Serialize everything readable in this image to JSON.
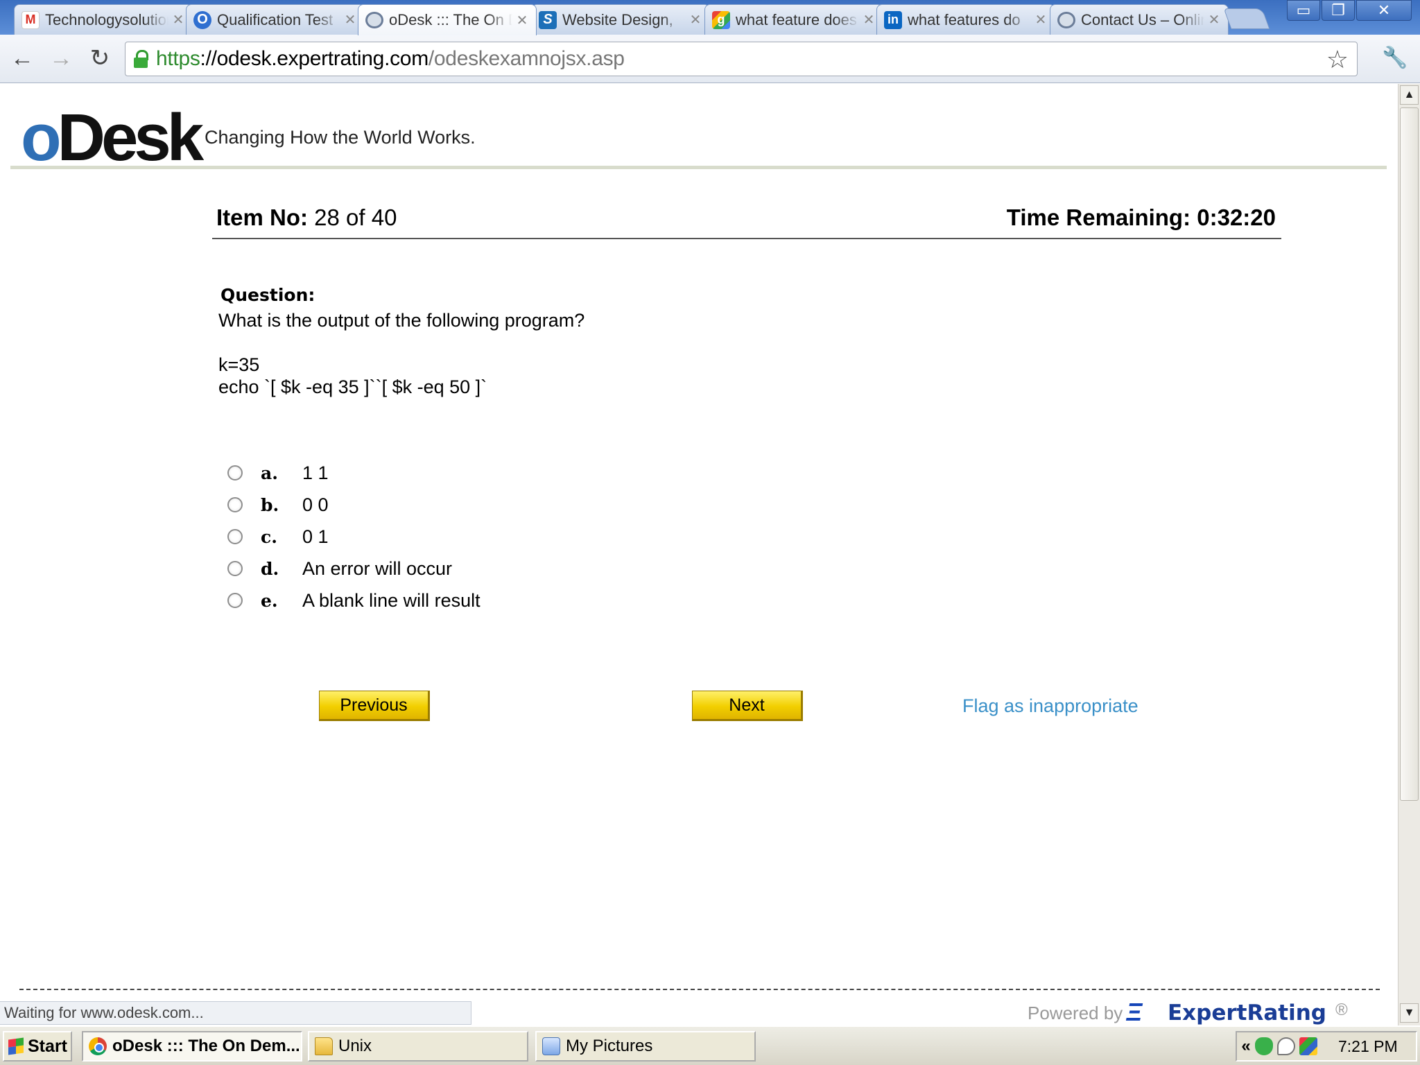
{
  "browser": {
    "tabs": [
      {
        "title": "Technologysolutions",
        "favicon": "gmail-icon",
        "active": false
      },
      {
        "title": "Qualification Test",
        "favicon": "odesk-icon",
        "active": false
      },
      {
        "title": "oDesk ::: The On Demand",
        "favicon": "globe-icon",
        "active": true
      },
      {
        "title": "Website Design,",
        "favicon": "skype-icon",
        "active": false
      },
      {
        "title": "what feature does",
        "favicon": "google-icon",
        "active": false
      },
      {
        "title": "what features do",
        "favicon": "linkedin-icon",
        "active": false
      },
      {
        "title": "Contact Us – Online",
        "favicon": "globe-icon",
        "active": false
      }
    ],
    "close_glyph": "✕",
    "window_buttons": {
      "minimize": "▭",
      "restore": "❐",
      "close": "✕"
    },
    "url": {
      "scheme": "https",
      "separator": "://",
      "host": "odesk.expertrating.com",
      "path": "/odeskexamnojsx.asp"
    },
    "status_text": "Waiting for www.odesk.com..."
  },
  "page": {
    "logo": {
      "o": "o",
      "desk": "Desk"
    },
    "tagline": "Changing How the World Works.",
    "item_label": "Item No:",
    "item_value": "28 of 40",
    "time_label": "Time Remaining:",
    "time_value": "0:32:20",
    "question_heading": "Question:",
    "question_text": "What is the output of the following program?",
    "code_lines": [
      "k=35",
      "echo `[ $k -eq 35 ]``[ $k -eq 50 ]`"
    ],
    "options": [
      {
        "letter": "a.",
        "text": "1 1"
      },
      {
        "letter": "b.",
        "text": "0 0"
      },
      {
        "letter": "c.",
        "text": "0 1"
      },
      {
        "letter": "d.",
        "text": "An error will occur"
      },
      {
        "letter": "e.",
        "text": "A blank line will result"
      }
    ],
    "previous_label": "Previous",
    "next_label": "Next",
    "flag_label": "Flag as inappropriate",
    "powered_by": "Powered by",
    "expertrating": "ExpertRating",
    "registered": "®"
  },
  "taskbar": {
    "start_label": "Start",
    "tasks": [
      {
        "label": "oDesk ::: The On Dem...",
        "icon": "chrome-icon",
        "active": true
      },
      {
        "label": "Unix",
        "icon": "folder-icon",
        "active": false
      },
      {
        "label": "My Pictures",
        "icon": "pictures-icon",
        "active": false
      }
    ],
    "tray_chevron": "«",
    "clock": "7:21 PM"
  },
  "colors": {
    "accent_yellow": "#f2cf00",
    "link_blue": "#3a90c8",
    "url_green": "#2e8b2e",
    "odesk_blue": "#2f6fb5",
    "expertrating_blue": "#1a3d96"
  }
}
